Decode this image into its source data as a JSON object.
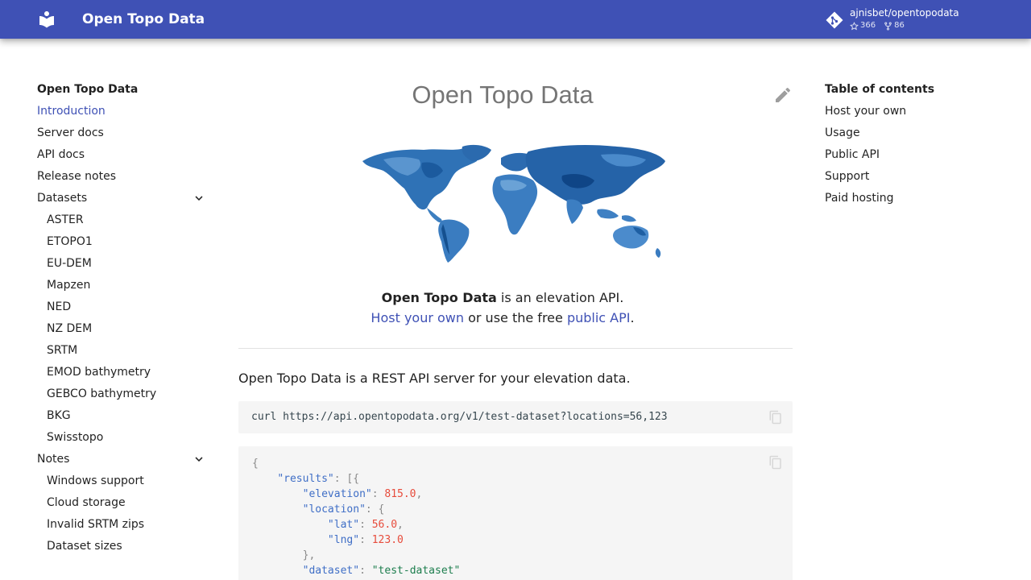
{
  "header": {
    "site_title": "Open Topo Data",
    "repo_name": "ajnisbet/opentopodata",
    "stars": "366",
    "forks": "86",
    "brand_color": "#3f51b5"
  },
  "nav": {
    "title": "Open Topo Data",
    "items": [
      {
        "label": "Introduction"
      },
      {
        "label": "Server docs"
      },
      {
        "label": "API docs"
      },
      {
        "label": "Release notes"
      },
      {
        "label": "Datasets"
      },
      {
        "label": "ASTER"
      },
      {
        "label": "ETOPO1"
      },
      {
        "label": "EU-DEM"
      },
      {
        "label": "Mapzen"
      },
      {
        "label": "NED"
      },
      {
        "label": "NZ DEM"
      },
      {
        "label": "SRTM"
      },
      {
        "label": "EMOD bathymetry"
      },
      {
        "label": "GEBCO bathymetry"
      },
      {
        "label": "BKG"
      },
      {
        "label": "Swisstopo"
      },
      {
        "label": "Notes"
      },
      {
        "label": "Windows support"
      },
      {
        "label": "Cloud storage"
      },
      {
        "label": "Invalid SRTM zips"
      },
      {
        "label": "Dataset sizes"
      }
    ]
  },
  "toc": {
    "title": "Table of contents",
    "items": [
      {
        "label": "Host your own"
      },
      {
        "label": "Usage"
      },
      {
        "label": "Public API"
      },
      {
        "label": "Support"
      },
      {
        "label": "Paid hosting"
      }
    ]
  },
  "content": {
    "title": "Open Topo Data",
    "tagline_bold": "Open Topo Data",
    "tagline_rest": " is an elevation API.",
    "host_link": "Host your own",
    "or_text": " or use the free ",
    "public_link": "public API",
    "period": ".",
    "intro": "Open Topo Data is a REST API server for your elevation data.",
    "curl_command": "curl https://api.opentopodata.org/v1/test-dataset?locations=56,123",
    "json": {
      "open": "{",
      "results_key": "\"results\"",
      "results_open": ": [{",
      "elevation_key": "\"elevation\"",
      "elevation_val": "815.0",
      "location_key": "\"location\"",
      "location_open": ": {",
      "lat_key": "\"lat\"",
      "lat_val": "56.0",
      "lng_key": "\"lng\"",
      "lng_val": "123.0",
      "location_close": "},",
      "dataset_key": "\"dataset\"",
      "dataset_val": "\"test-dataset\""
    }
  }
}
